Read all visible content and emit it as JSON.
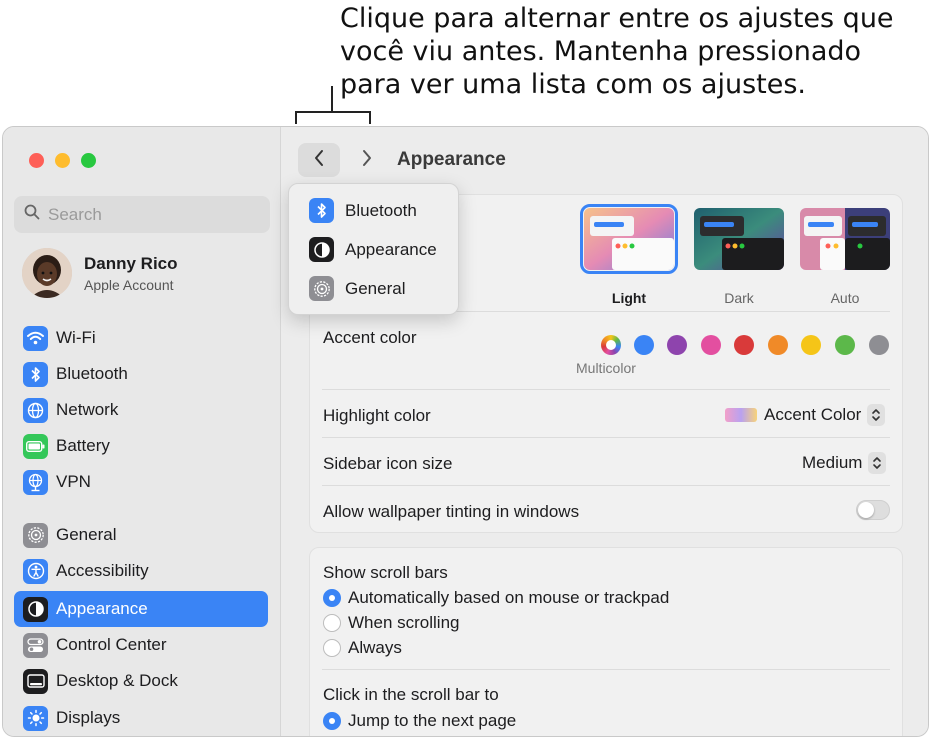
{
  "callout": {
    "line1": "Clique para alternar entre os ajustes que",
    "line2": "você viu antes. Mantenha pressionado",
    "line3": "para ver uma lista com os ajustes."
  },
  "sidebar": {
    "search_placeholder": "Search",
    "user": {
      "name": "Danny Rico",
      "subtitle": "Apple Account"
    },
    "items": [
      {
        "label": "Wi-Fi",
        "icon": "wifi-icon",
        "color": "#3a84f5"
      },
      {
        "label": "Bluetooth",
        "icon": "bluetooth-icon",
        "color": "#3a84f5"
      },
      {
        "label": "Network",
        "icon": "globe-icon",
        "color": "#3a84f5"
      },
      {
        "label": "Battery",
        "icon": "battery-icon",
        "color": "#34c759"
      },
      {
        "label": "VPN",
        "icon": "vpn-globe-icon",
        "color": "#3a84f5"
      },
      {
        "label": "General",
        "icon": "gear-icon",
        "color": "#8e8e93"
      },
      {
        "label": "Accessibility",
        "icon": "accessibility-icon",
        "color": "#3a84f5"
      },
      {
        "label": "Appearance",
        "icon": "appearance-icon",
        "color": "#1d1d1f",
        "selected": true
      },
      {
        "label": "Control Center",
        "icon": "control-center-icon",
        "color": "#8e8e93"
      },
      {
        "label": "Desktop & Dock",
        "icon": "dock-icon",
        "color": "#1d1d1f"
      },
      {
        "label": "Displays",
        "icon": "sun-icon",
        "color": "#3a84f5"
      }
    ]
  },
  "header": {
    "title": "Appearance"
  },
  "history_menu": {
    "items": [
      {
        "label": "Bluetooth",
        "icon": "bluetooth-icon"
      },
      {
        "label": "Appearance",
        "icon": "appearance-icon"
      },
      {
        "label": "General",
        "icon": "gear-icon"
      }
    ]
  },
  "appearance": {
    "themes": [
      {
        "label": "Light",
        "selected": true
      },
      {
        "label": "Dark",
        "selected": false
      },
      {
        "label": "Auto",
        "selected": false
      }
    ],
    "accent_label": "Accent color",
    "accent_colors": [
      "#3a84f5",
      "#8e44ad",
      "#e34fa0",
      "#d93a3a",
      "#f08a28",
      "#f5c518",
      "#5cb84a",
      "#8e8e93"
    ],
    "accent_selected_name": "Multicolor",
    "highlight_label": "Highlight color",
    "highlight_value": "Accent Color",
    "sidebar_icon_label": "Sidebar icon size",
    "sidebar_icon_value": "Medium",
    "wallpaper_tint_label": "Allow wallpaper tinting in windows",
    "wallpaper_tint_on": false
  },
  "scroll": {
    "show_label": "Show scroll bars",
    "show_options": [
      {
        "label": "Automatically based on mouse or trackpad",
        "selected": true
      },
      {
        "label": "When scrolling",
        "selected": false
      },
      {
        "label": "Always",
        "selected": false
      }
    ],
    "click_label": "Click in the scroll bar to",
    "click_options": [
      {
        "label": "Jump to the next page",
        "selected": true
      }
    ]
  }
}
